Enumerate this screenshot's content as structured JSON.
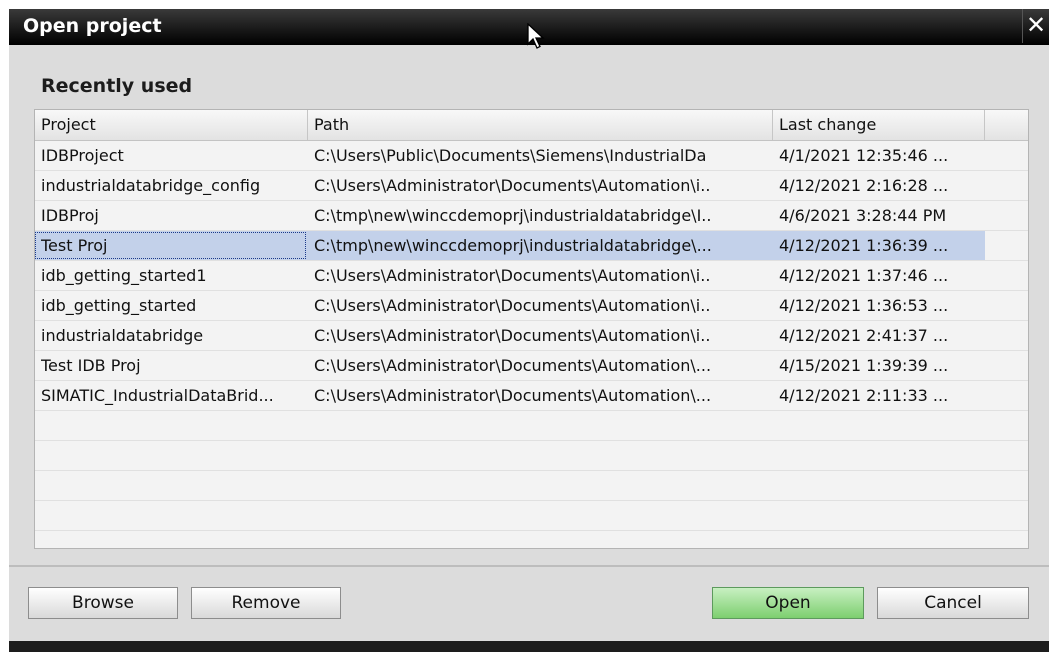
{
  "window": {
    "title": "Open project"
  },
  "section": {
    "title": "Recently used"
  },
  "table": {
    "columns": {
      "project": "Project",
      "path": "Path",
      "last_change": "Last change"
    },
    "rows": [
      {
        "project": "IDBProject",
        "path": "C:\\Users\\Public\\Documents\\Siemens\\IndustrialDa",
        "last_change": "4/1/2021 12:35:46 ..."
      },
      {
        "project": "industrialdatabridge_config",
        "path": "C:\\Users\\Administrator\\Documents\\Automation\\i..",
        "last_change": "4/12/2021 2:16:28 ..."
      },
      {
        "project": "IDBProj",
        "path": "C:\\tmp\\new\\winccdemoprj\\industrialdatabridge\\I..",
        "last_change": "4/6/2021 3:28:44 PM"
      },
      {
        "project": "Test Proj",
        "path": "C:\\tmp\\new\\winccdemoprj\\industrialdatabridge\\...",
        "last_change": "4/12/2021 1:36:39 ..."
      },
      {
        "project": "idb_getting_started1",
        "path": "C:\\Users\\Administrator\\Documents\\Automation\\i..",
        "last_change": "4/12/2021 1:37:46 ..."
      },
      {
        "project": "idb_getting_started",
        "path": "C:\\Users\\Administrator\\Documents\\Automation\\i..",
        "last_change": "4/12/2021 1:36:53 ..."
      },
      {
        "project": "industrialdatabridge",
        "path": "C:\\Users\\Administrator\\Documents\\Automation\\i..",
        "last_change": "4/12/2021 2:41:37 ..."
      },
      {
        "project": "Test IDB Proj",
        "path": "C:\\Users\\Administrator\\Documents\\Automation\\...",
        "last_change": "4/15/2021 1:39:39 ..."
      },
      {
        "project": "SIMATIC_IndustrialDataBrid...",
        "path": "C:\\Users\\Administrator\\Documents\\Automation\\...",
        "last_change": "4/12/2021 2:11:33 ..."
      }
    ],
    "selected_index": 3
  },
  "buttons": {
    "browse": "Browse",
    "remove": "Remove",
    "open": "Open",
    "cancel": "Cancel"
  },
  "icons": {
    "close": "close-icon",
    "cursor": "mouse-cursor-icon"
  },
  "colors": {
    "selection": "#c3d1ea",
    "open_button": "#7dcf6f",
    "titlebar": "#000000"
  }
}
